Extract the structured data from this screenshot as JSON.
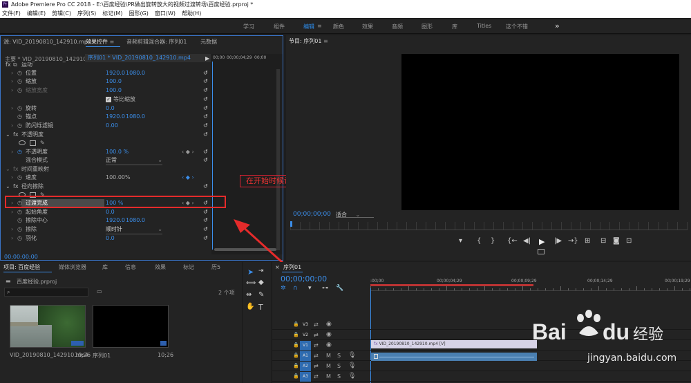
{
  "app": {
    "title": "Adobe Premiere Pro CC 2018 - E:\\百度经验\\PR做出旋转放大的视频过渡转场\\百度经验.prproj *"
  },
  "menu": [
    "文件(F)",
    "编辑(E)",
    "剪辑(C)",
    "序列(S)",
    "标记(M)",
    "图形(G)",
    "窗口(W)",
    "帮助(H)"
  ],
  "workspace": {
    "tabs": [
      "学习",
      "组件",
      "编辑",
      "颜色",
      "效果",
      "音频",
      "图形",
      "库",
      "Titles",
      "这个不错"
    ],
    "active": 2,
    "more": "»"
  },
  "source_panel": {
    "tabs": [
      "源: VID_20190810_142910.mp4",
      "效果控件",
      "音频剪辑混合器: 序列01",
      "元数据"
    ],
    "master": "主要 * VID_20190810_142910.mp4",
    "seq": "序列01 * VID_20190810_142910.mp4",
    "ruler_times": [
      "00;00",
      "00;00;04;29",
      "00;00"
    ],
    "timecode": "00;00;00;00"
  },
  "effects": {
    "motion_label": "运动",
    "rows": [
      {
        "label": "位置",
        "v1": "1920.0",
        "v2": "1080.0"
      },
      {
        "label": "缩放",
        "v1": "100.0",
        "v2": ""
      },
      {
        "label": "缩放宽度",
        "v1": "100.0",
        "v2": ""
      },
      {
        "label": "等比缩放",
        "v1": "",
        "v2": ""
      },
      {
        "label": "旋转",
        "v1": "0.0",
        "v2": ""
      },
      {
        "label": "锚点",
        "v1": "1920.0",
        "v2": "1080.0"
      },
      {
        "label": "防闪烁滤镜",
        "v1": "0.00",
        "v2": ""
      }
    ],
    "opacity_group": "不透明度",
    "opacity": {
      "label": "不透明度",
      "value": "100.0 %"
    },
    "blend": {
      "label": "混合模式",
      "value": "正常"
    },
    "timeremap": "时间重映射",
    "speed": {
      "label": "速度",
      "value": "100.00%"
    },
    "wipe_group": "径向擦除",
    "transition": {
      "label": "过渡完成",
      "value": "100 %"
    },
    "start_angle": {
      "label": "起始角度",
      "value": "0.0"
    },
    "wipe_center": {
      "label": "擦除中心",
      "v1": "1920.0",
      "v2": "1080.0"
    },
    "wipe": {
      "label": "擦除",
      "value": "顺时针"
    },
    "feather": {
      "label": "羽化",
      "value": "0.0"
    }
  },
  "annotation": "在开始时候设置过渡完成为100%",
  "program_monitor": {
    "title": "节目: 序列01",
    "timecode": "00;00;00;00",
    "fit": "适合"
  },
  "project_panel": {
    "tabs": [
      "项目: 百度经验",
      "媒体浏览器",
      "库",
      "信息",
      "效果",
      "标记",
      "历5"
    ],
    "file": "百度经验.prproj",
    "item_count": "2 个项",
    "clips": [
      {
        "name": "VID_20190810_142910.mp4",
        "dur": "10;26"
      },
      {
        "name": "序列01",
        "dur": "10;26"
      }
    ]
  },
  "timeline": {
    "tab": "序列01",
    "timecode": "00;00;00;00",
    "ruler": [
      ":00;00",
      "00;00;04;29",
      "00;00;09;29",
      "00;00;14;29",
      "00;00;19;29"
    ],
    "video_tracks": [
      "V3",
      "V2",
      "V1"
    ],
    "audio_tracks": [
      "A1",
      "A2",
      "A3"
    ],
    "clip_label": "VID_20190810_142910.mp4 [V]",
    "m": "M",
    "s": "S"
  },
  "watermark": {
    "brand": "Bai",
    "brand2": "du",
    "brand3": "经验",
    "url": "jingyan.baidu.com"
  }
}
